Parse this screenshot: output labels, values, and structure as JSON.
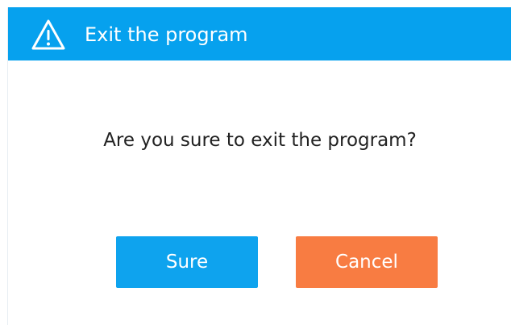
{
  "dialog": {
    "title": "Exit the program",
    "title_icon": "warning-triangle-icon",
    "message": "Are you sure to exit the program?",
    "confirm_label": "Sure",
    "cancel_label": "Cancel"
  },
  "colors": {
    "title_bar": "#06a1ee",
    "confirm_button": "#0ea3ee",
    "cancel_button": "#f87c42"
  }
}
